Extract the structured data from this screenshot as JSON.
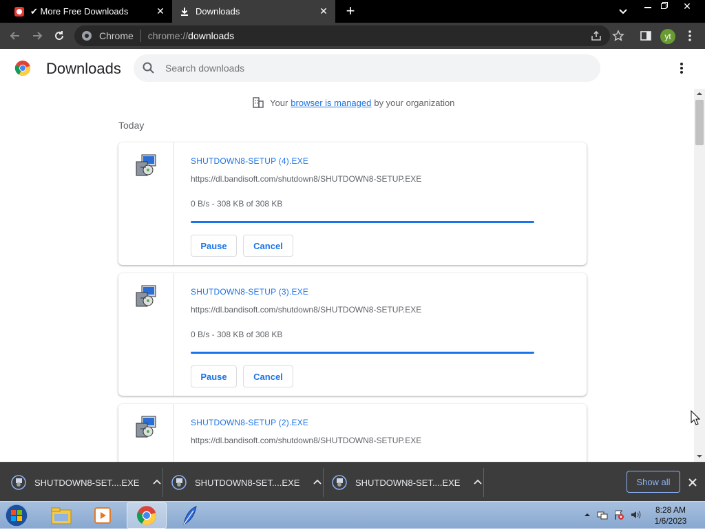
{
  "browser": {
    "tabs": [
      {
        "title": "✔ More Free Downloads",
        "active": false
      },
      {
        "title": "Downloads",
        "active": true
      }
    ],
    "omnibox": {
      "site_label": "Chrome",
      "url_scheme": "chrome://",
      "url_host": "downloads"
    },
    "avatar_initials": "yt"
  },
  "page": {
    "title": "Downloads",
    "search_placeholder": "Search downloads",
    "managed_notice": {
      "prefix": "Your",
      "link": "browser is managed",
      "suffix": "by your organization"
    },
    "section_label": "Today"
  },
  "downloads": [
    {
      "name": "SHUTDOWN8-SETUP (4).EXE",
      "url": "https://dl.bandisoft.com/shutdown8/SHUTDOWN8-SETUP.EXE",
      "status": "0 B/s - 308 KB of 308 KB",
      "progress": 1.0,
      "pause_label": "Pause",
      "cancel_label": "Cancel"
    },
    {
      "name": "SHUTDOWN8-SETUP (3).EXE",
      "url": "https://dl.bandisoft.com/shutdown8/SHUTDOWN8-SETUP.EXE",
      "status": "0 B/s - 308 KB of 308 KB",
      "progress": 1.0,
      "pause_label": "Pause",
      "cancel_label": "Cancel"
    },
    {
      "name": "SHUTDOWN8-SETUP (2).EXE",
      "url": "https://dl.bandisoft.com/shutdown8/SHUTDOWN8-SETUP.EXE"
    }
  ],
  "shelf": {
    "items": [
      {
        "name": "SHUTDOWN8-SET....EXE"
      },
      {
        "name": "SHUTDOWN8-SET....EXE"
      },
      {
        "name": "SHUTDOWN8-SET....EXE"
      }
    ],
    "show_all_label": "Show all"
  },
  "taskbar": {
    "time": "8:28 AM",
    "date": "1/6/2023"
  },
  "colors": {
    "accent": "#1a73e8",
    "tab_strip": "#000000",
    "toolbar": "#3c3c3c",
    "shelf": "#3c3c3c"
  }
}
